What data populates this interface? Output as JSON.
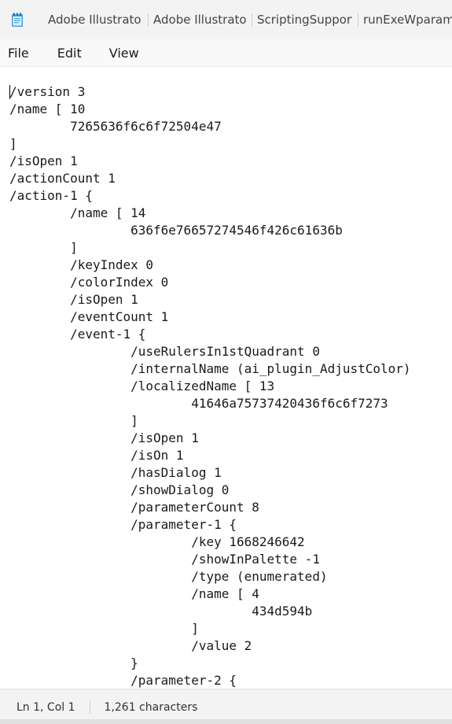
{
  "tabs": [
    {
      "label": "Adobe Illustrator"
    },
    {
      "label": "Adobe Illustrator"
    },
    {
      "label": "ScriptingSupport.aip"
    },
    {
      "label": "runExeWparameters"
    }
  ],
  "app_icon": "notepad-icon",
  "menu": {
    "file": "File",
    "edit": "Edit",
    "view": "View"
  },
  "editor": {
    "content": "/version 3\n/name [ 10\n\t7265636f6c6f72504e47\n]\n/isOpen 1\n/actionCount 1\n/action-1 {\n\t/name [ 14\n\t\t636f6e76657274546f426c61636b\n\t]\n\t/keyIndex 0\n\t/colorIndex 0\n\t/isOpen 1\n\t/eventCount 1\n\t/event-1 {\n\t\t/useRulersIn1stQuadrant 0\n\t\t/internalName (ai_plugin_AdjustColor)\n\t\t/localizedName [ 13\n\t\t\t41646a75737420436f6c6f7273\n\t\t]\n\t\t/isOpen 1\n\t\t/isOn 1\n\t\t/hasDialog 1\n\t\t/showDialog 0\n\t\t/parameterCount 8\n\t\t/parameter-1 {\n\t\t\t/key 1668246642\n\t\t\t/showInPalette -1\n\t\t\t/type (enumerated)\n\t\t\t/name [ 4\n\t\t\t\t434d594b\n\t\t\t]\n\t\t\t/value 2\n\t\t}\n\t\t/parameter-2 {"
  },
  "status": {
    "position": "Ln 1, Col 1",
    "characters": "1,261 characters"
  }
}
